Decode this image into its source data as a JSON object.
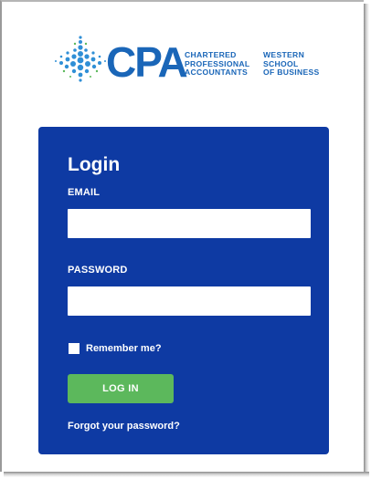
{
  "logo": {
    "wordmark": "CPA",
    "line1_col1": "CHARTERED",
    "line2_col1": "PROFESSIONAL",
    "line3_col1": "ACCOUNTANTS",
    "line1_col2": "WESTERN",
    "line2_col2": "SCHOOL",
    "line3_col2": "OF BUSINESS",
    "brand_color": "#1a66b8",
    "leaf_color": "#2f8fd6",
    "accent_green": "#5cb85c"
  },
  "login": {
    "title": "Login",
    "email_label": "EMAIL",
    "email_value": "",
    "password_label": "PASSWORD",
    "password_value": "",
    "remember_label": "Remember me?",
    "remember_checked": false,
    "submit_label": "LOG IN",
    "forgot_label": "Forgot your password?",
    "panel_color": "#0e3aa3",
    "button_color": "#5cb85c"
  }
}
